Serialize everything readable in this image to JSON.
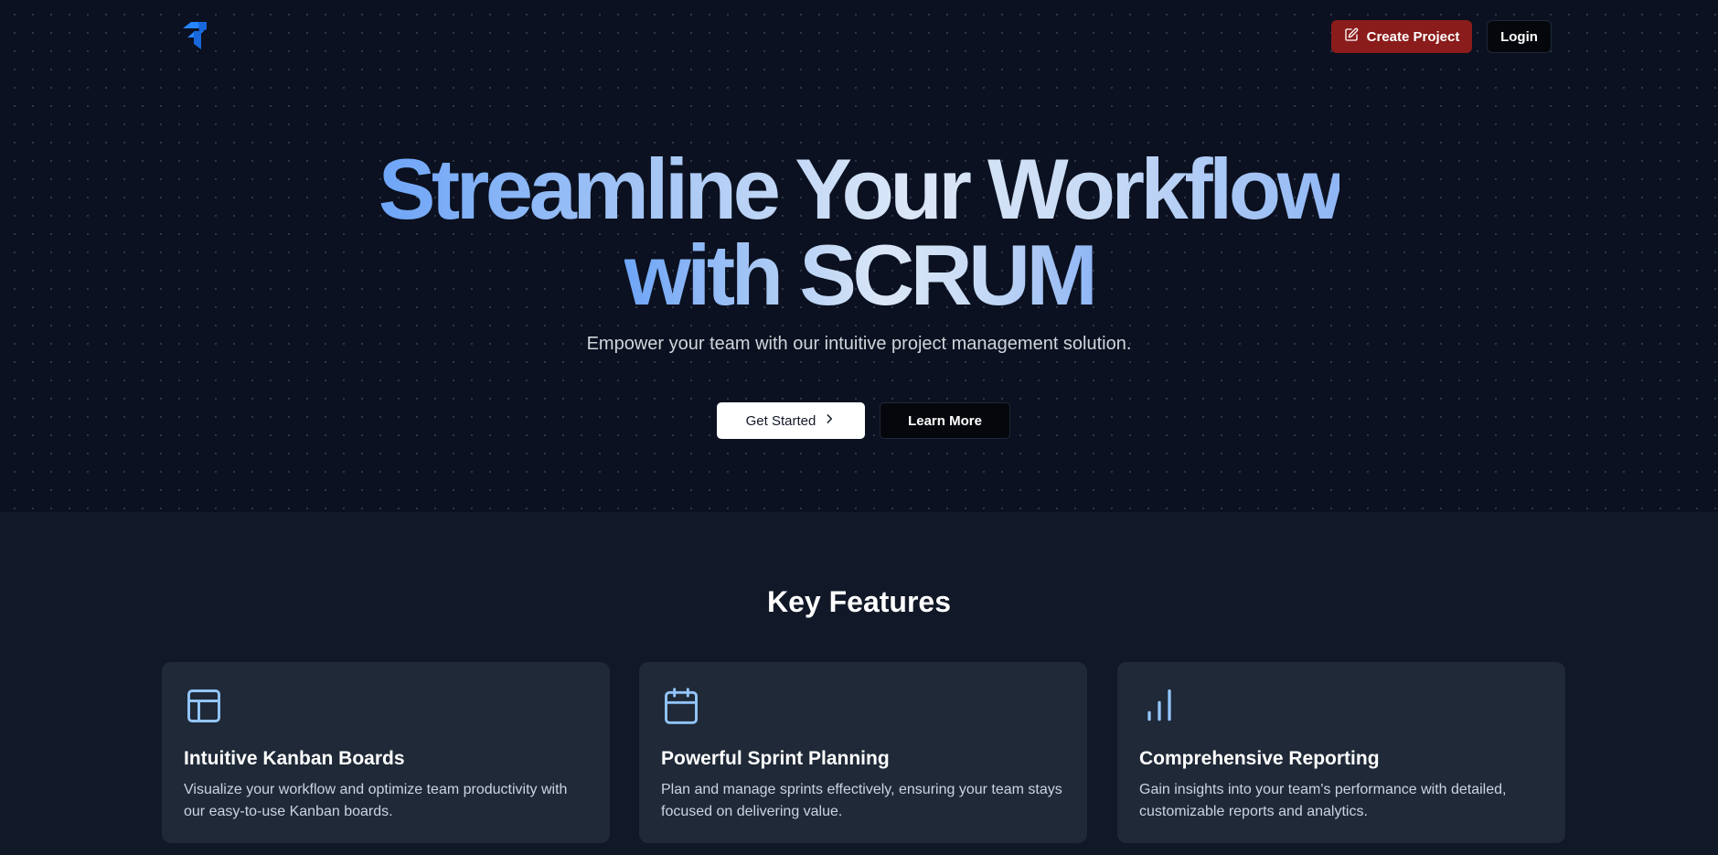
{
  "navbar": {
    "logo_icon": "jira-logo-icon",
    "create_project_label": "Create Project",
    "create_project_icon": "edit-icon",
    "login_label": "Login"
  },
  "hero": {
    "headline_line1": "Streamline Your Workflow",
    "headline_line2": "with SCRUM",
    "subtitle": "Empower your team with our intuitive project management solution.",
    "get_started_label": "Get Started",
    "get_started_icon": "chevron-right-icon",
    "learn_more_label": "Learn More"
  },
  "features": {
    "title": "Key Features",
    "cards": [
      {
        "icon": "layout-icon",
        "title": "Intuitive Kanban Boards",
        "description": "Visualize your workflow and optimize team productivity with our easy-to-use Kanban boards."
      },
      {
        "icon": "calendar-icon",
        "title": "Powerful Sprint Planning",
        "description": "Plan and manage sprints effectively, ensuring your team stays focused on delivering value."
      },
      {
        "icon": "bar-chart-icon",
        "title": "Comprehensive Reporting",
        "description": "Gain insights into your team's performance with detailed, customizable reports and analytics."
      }
    ]
  },
  "colors": {
    "background": "#0b1120",
    "section_background": "#111827",
    "card_background": "#1f2937",
    "accent_red": "#8b1c1c",
    "icon_blue": "#93c5fd",
    "logo_blue": "#2684ff"
  }
}
